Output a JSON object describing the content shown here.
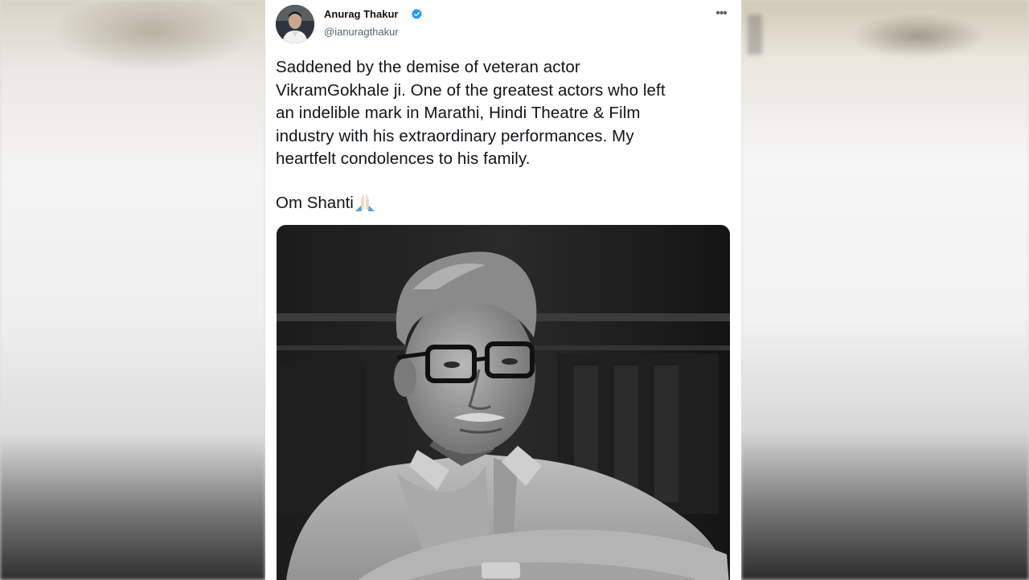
{
  "tweet": {
    "author": {
      "name": "Anurag Thakur",
      "handle": "@ianuragthakur",
      "verified": true
    },
    "body_lines": [
      "Saddened by the demise of veteran actor",
      "VikramGokhale ji. One of the greatest actors who left",
      "an indelible mark in Marathi, Hindi Theatre & Film",
      "industry with his extraordinary performances. My",
      "heartfelt condolences to his family."
    ],
    "signoff": "Om Shanti",
    "signoff_emoji": "folded-hands-icon",
    "more_menu_icon": "more-horizontal-icon",
    "colors": {
      "verified_badge": "#1d9bf0",
      "text": "#0f1419",
      "secondary_text": "#536471"
    }
  }
}
